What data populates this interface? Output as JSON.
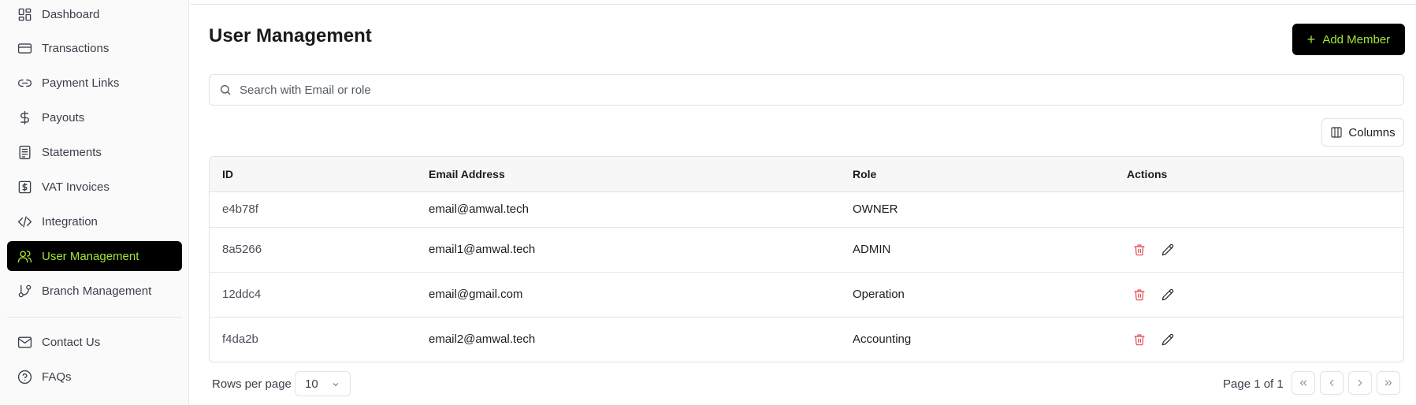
{
  "sidebar": {
    "items": [
      {
        "label": "Dashboard",
        "icon": "dashboard-icon",
        "active": false
      },
      {
        "label": "Transactions",
        "icon": "card-icon",
        "active": false
      },
      {
        "label": "Payment Links",
        "icon": "link-icon",
        "active": false
      },
      {
        "label": "Payouts",
        "icon": "dollar-icon",
        "active": false
      },
      {
        "label": "Statements",
        "icon": "document-icon",
        "active": false
      },
      {
        "label": "VAT Invoices",
        "icon": "invoice-icon",
        "active": false
      },
      {
        "label": "Integration",
        "icon": "code-icon",
        "active": false
      },
      {
        "label": "User Management",
        "icon": "users-icon",
        "active": true
      },
      {
        "label": "Branch Management",
        "icon": "branch-icon",
        "active": false
      }
    ],
    "footer_items": [
      {
        "label": "Contact Us",
        "icon": "mail-icon"
      },
      {
        "label": "FAQs",
        "icon": "help-icon"
      }
    ]
  },
  "main": {
    "title": "User Management",
    "add_button_label": "Add Member",
    "search_placeholder": "Search with Email or role",
    "columns_button_label": "Columns"
  },
  "table": {
    "headers": [
      "ID",
      "Email Address",
      "Role",
      "Actions"
    ],
    "rows": [
      {
        "id": "e4b78f",
        "email": "email@amwal.tech",
        "role": "OWNER",
        "actions": false
      },
      {
        "id": "8a5266",
        "email": "email1@amwal.tech",
        "role": "ADMIN",
        "actions": true
      },
      {
        "id": "12ddc4",
        "email": "email@gmail.com",
        "role": "Operation",
        "actions": true
      },
      {
        "id": "f4da2b",
        "email": "email2@amwal.tech",
        "role": "Accounting",
        "actions": true
      }
    ]
  },
  "pagination": {
    "rows_per_page_label": "Rows per page",
    "rows_per_page_value": "10",
    "page_info": "Page 1 of 1"
  },
  "colors": {
    "accent": "#a3e635",
    "active_bg": "#000000",
    "delete": "#e5484d"
  }
}
